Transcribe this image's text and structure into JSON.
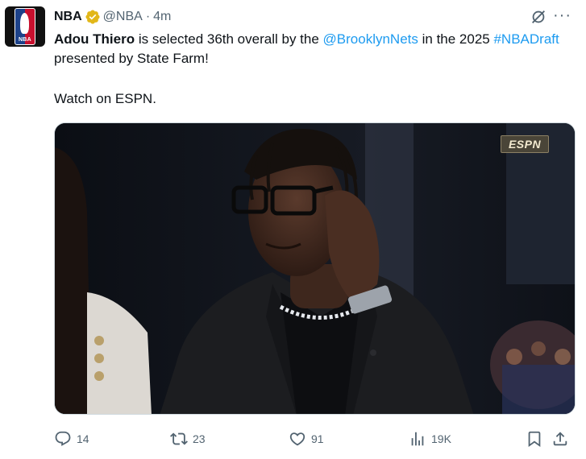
{
  "tweet": {
    "author_name": "NBA",
    "handle": "@NBA",
    "separator": "·",
    "time": "4m",
    "logo_text": "NBA",
    "text_parts": {
      "name": "Adou Thiero",
      "part1": " is selected 36th overall by the ",
      "mention": "@BrooklynNets",
      "part2": " in the 2025 ",
      "hashtag": "#NBADraft",
      "part3": " presented by State Farm!"
    },
    "second_line": "Watch on ESPN.",
    "media": {
      "network_badge": "ESPN"
    }
  },
  "actions": {
    "replies": "14",
    "reposts": "23",
    "likes": "91",
    "views": "19K"
  },
  "colors": {
    "link": "#1d9bf0",
    "secondary": "#536471",
    "verified": "#e2b719"
  },
  "icons": [
    "grok-icon",
    "more-icon",
    "reply-icon",
    "repost-icon",
    "like-icon",
    "views-icon",
    "bookmark-icon",
    "share-icon",
    "verified-badge-icon"
  ]
}
